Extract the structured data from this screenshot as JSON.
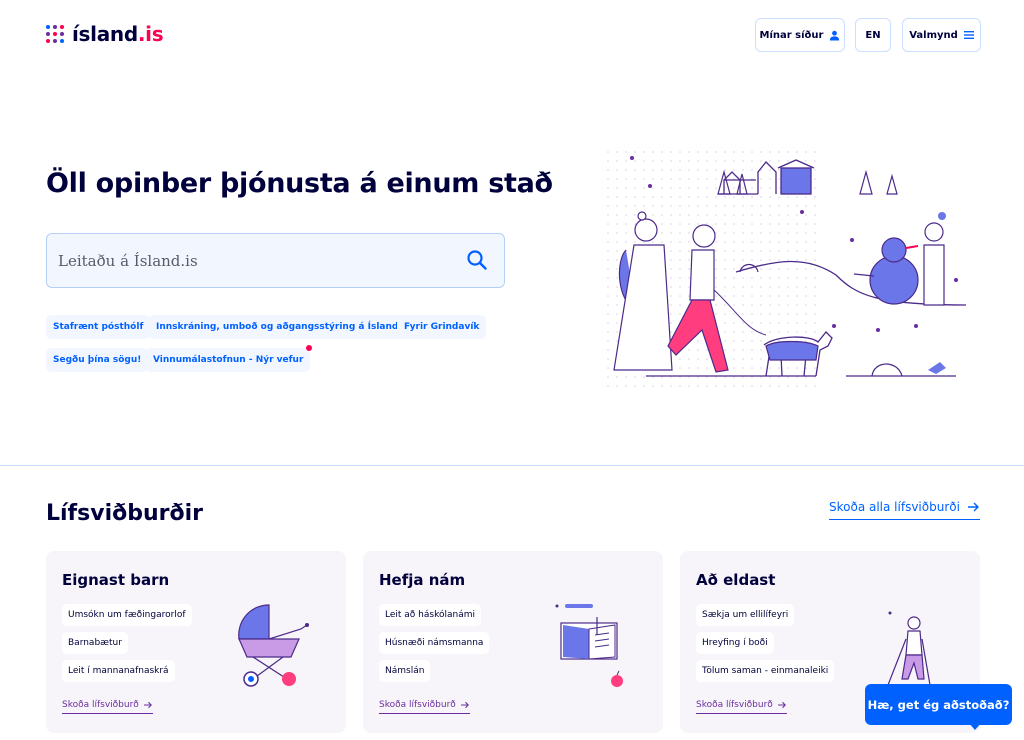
{
  "header": {
    "logo_text": "ísland",
    "logo_suffix": ".is",
    "my_pages_label": "Mínar síður",
    "language_label": "EN",
    "menu_label": "Valmynd"
  },
  "hero": {
    "title": "Öll opinber þjónusta á einum stað",
    "search_placeholder": "Leitaðu á Ísland.is",
    "tags": [
      "Stafrænt pósthólf",
      "Innskráning, umboð og aðgangsstýring á Ísland.is",
      "Fyrir Grindavík",
      "Segðu þína sögu!",
      "Vinnumálastofnun - Nýr vefur"
    ]
  },
  "life_events": {
    "title": "Lífsviðburðir",
    "see_all_label": "Skoða alla lífsviðburði",
    "cards": [
      {
        "title": "Eignast barn",
        "links": [
          "Umsókn um fæðingarorlof",
          "Barnabætur",
          "Leit í mannanafnaskrá"
        ],
        "more_label": "Skoða lífsviðburð"
      },
      {
        "title": "Hefja nám",
        "links": [
          "Leit að háskólanámi",
          "Húsnæði námsmanna",
          "Námslán"
        ],
        "more_label": "Skoða lífsviðburð"
      },
      {
        "title": "Að eldast",
        "links": [
          "Sækja um ellilífeyri",
          "Hreyfing í boði",
          "Tölum saman - einmanaleiki"
        ],
        "more_label": "Skoða lífsviðburð"
      }
    ]
  },
  "chat": {
    "label": "Hæ, get ég aðstoðað?"
  },
  "colors": {
    "brand_blue": "#0061ff",
    "dark_text": "#00003c",
    "accent_red": "#ff0050",
    "accent_purple": "#6a2ea0"
  }
}
